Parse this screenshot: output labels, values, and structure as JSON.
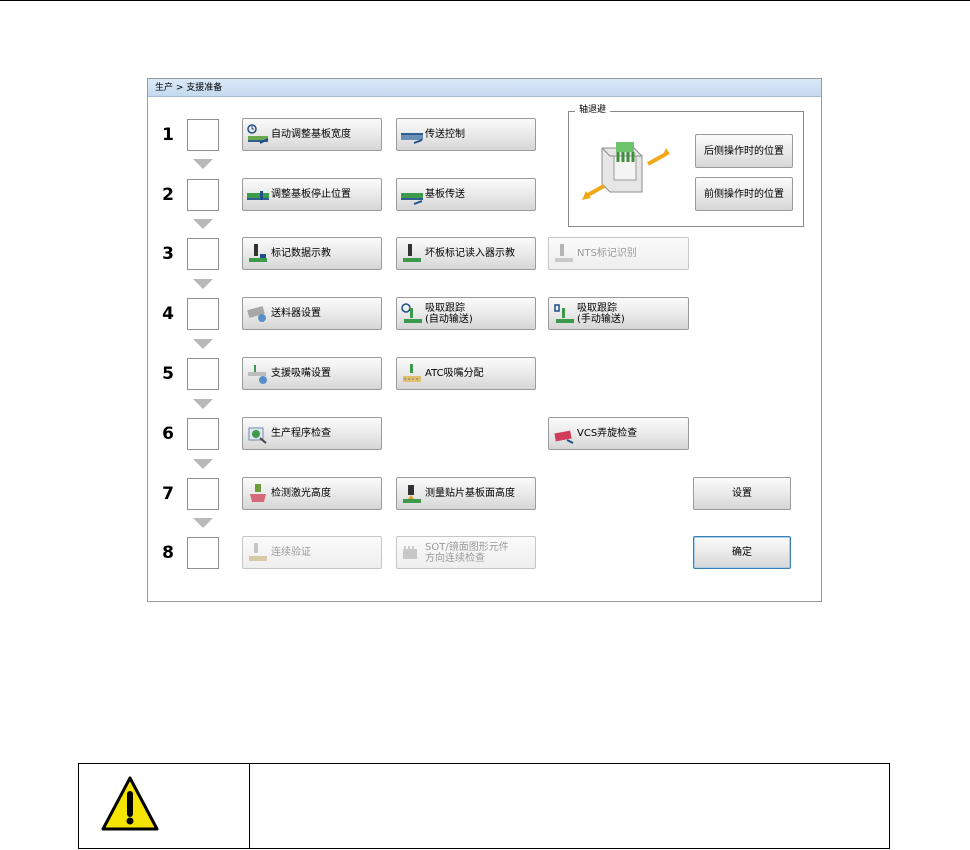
{
  "breadcrumb": "生产 > 支援准备",
  "steps": [
    "1",
    "2",
    "3",
    "4",
    "5",
    "6",
    "7",
    "8"
  ],
  "buttons": {
    "auto_adjust_width": "自动调整基板宽度",
    "transfer_control": "传送控制",
    "adjust_stop_position": "调整基板停止位置",
    "board_transfer": "基板传送",
    "mark_teaching": "标记数据示教",
    "bad_board_mark_teaching": "坏板标记读入器示教",
    "nts_mark_recognition": "NTS标记识别",
    "feeder_setup": "送料器设置",
    "pickup_follow_auto_l1": "吸取跟踪",
    "pickup_follow_auto_l2": "(自动输送)",
    "pickup_follow_manual_l1": "吸取跟踪",
    "pickup_follow_manual_l2": "(手动输送)",
    "support_nozzle_setup": "支援吸嘴设置",
    "atc_nozzle_assign": "ATC吸嘴分配",
    "program_check": "生产程序检查",
    "vcs_check": "VCS弄旋检查",
    "laser_height_check": "检测激光高度",
    "measure_board_height": "测量贴片基板面高度",
    "settings": "设置",
    "continuous_verify": "连续验证",
    "sot_check_l1": "SOT/镜面图形元件",
    "sot_check_l2": "方向连续检查",
    "confirm": "确定"
  },
  "axis_group": {
    "title": "轴退避",
    "rear_position": "后侧操作时的位置",
    "front_position": "前侧操作时的位置"
  },
  "colors": {
    "accent": "#3c7fb1",
    "arrow": "#f0a818",
    "warning": "#f5e400"
  },
  "warning_icon": "warning-triangle-icon"
}
